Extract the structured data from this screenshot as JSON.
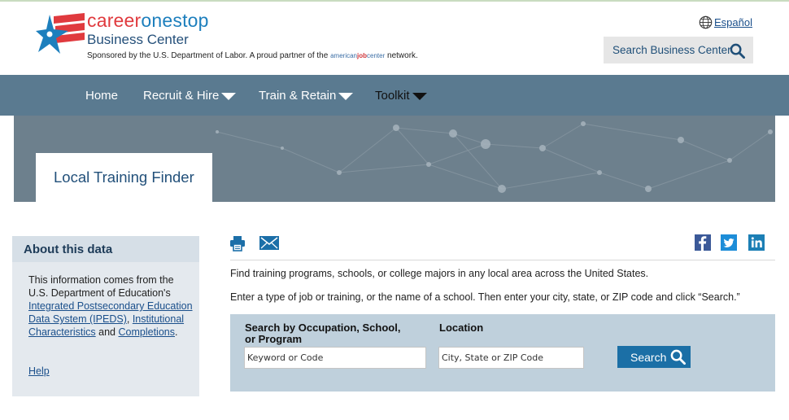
{
  "header": {
    "brand_part1": "career",
    "brand_part2": "onestop",
    "brand_subtitle": "Business Center",
    "sponsor_text": "Sponsored by the U.S. Department of Labor. A proud partner of the",
    "sponsor_partner_a": "american",
    "sponsor_partner_b": "job",
    "sponsor_partner_c": "center",
    "sponsor_suffix": "network.",
    "language_link": "Español",
    "search_button_label": "Search Business Center"
  },
  "nav": {
    "items": [
      {
        "label": "Home"
      },
      {
        "label": "Recruit & Hire"
      },
      {
        "label": "Train & Retain"
      },
      {
        "label": "Toolkit"
      }
    ]
  },
  "banner": {
    "title": "Local Training Finder"
  },
  "sidebar": {
    "heading": "About this data",
    "text_before": "This information comes from the U.S. Department of Education's",
    "link_ipeds": "Integrated Postsecondary Education Data System (IPEDS)",
    "link_institutional": "Institutional Characteristics",
    "text_and": "and",
    "link_completions": "Completions",
    "help_link": "Help"
  },
  "main": {
    "intro_1": "Find training programs, schools, or college majors in any local area across the United States.",
    "intro_2": "Enter a type of job or training, or the name of a school. Then enter your city, state, or ZIP code and click “Search.”",
    "search": {
      "occupation_label_line1": "Search by Occupation, School,",
      "occupation_label_line2": "or Program",
      "occupation_placeholder": "Keyword or Code",
      "location_label": "Location",
      "location_placeholder": "City, State or ZIP Code",
      "button_label": "Search"
    }
  },
  "colors": {
    "nav_bg": "#5a7a90",
    "banner_bg": "#6d808d",
    "search_panel_bg": "#bfd0dc",
    "search_button_bg": "#1b6fa6",
    "facebook": "#3b5998",
    "twitter": "#1d8dd8",
    "linkedin": "#1c7fb5"
  },
  "icons": {
    "print": "print-icon",
    "email": "email-icon",
    "facebook": "facebook-icon",
    "twitter": "twitter-icon",
    "linkedin": "linkedin-icon",
    "globe": "globe-icon",
    "search": "search-icon"
  }
}
